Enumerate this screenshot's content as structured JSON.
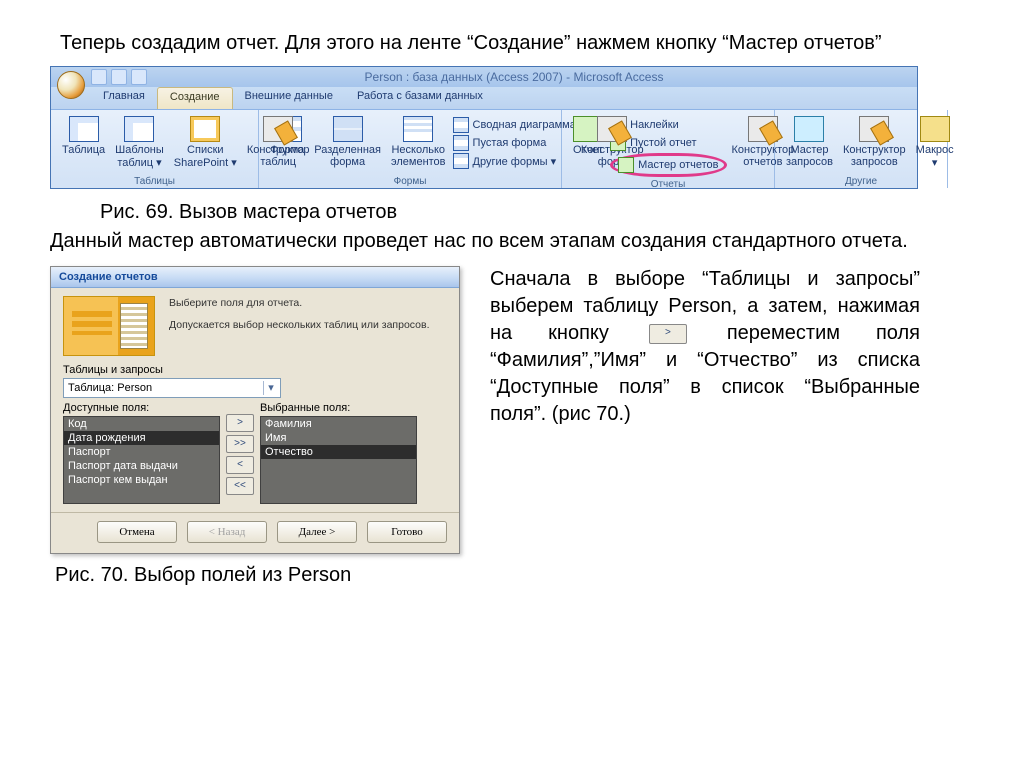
{
  "para1": "Теперь создадим отчет. Для этого на ленте “Создание” нажмем кнопку “Мастер отчетов”",
  "caption69": "Рис. 69. Вызов мастера отчетов",
  "para2": "Данный мастер автоматически проведет нас по всем этапам создания стандартного отчета.",
  "caption70": "Рис. 70. Выбор полей из Person",
  "aside": {
    "t1": "Сначала в выборе “Таблицы и запросы” выберем таблицу Person, а затем, нажимая на кнопку ",
    "btn": ">",
    "t2": " переместим поля “Фамилия”,”Имя” и “Отчество” из списка “Доступные поля” в список “Выбранные поля”. (рис 70.)"
  },
  "ribbon": {
    "title": "Person : база данных (Access 2007) - Microsoft Access",
    "tabs": {
      "home": "Главная",
      "create": "Создание",
      "external": "Внешние данные",
      "db": "Работа с базами данных"
    },
    "groups": {
      "tables": {
        "title": "Таблицы",
        "table": "Таблица",
        "templates": "Шаблоны\nтаблиц ▾",
        "sharepoint": "Списки\nSharePoint ▾",
        "design": "Конструктор\nтаблиц"
      },
      "forms": {
        "title": "Формы",
        "form": "Форма",
        "split": "Разделенная\nформа",
        "multi": "Несколько\nэлементов",
        "pivot": "Сводная диаграмма",
        "blank": "Пустая форма",
        "more": "Другие формы ▾",
        "design": "Конструктор\nформ"
      },
      "reports": {
        "title": "Отчеты",
        "report": "Отчет",
        "labels": "Наклейки",
        "blank": "Пустой отчет",
        "wizard": "Мастер отчетов",
        "design": "Конструктор\nотчетов"
      },
      "other": {
        "title": "Другие",
        "qwizard": "Мастер\nзапросов",
        "qdesign": "Конструктор\nзапросов",
        "macro": "Макрос\n▾"
      }
    }
  },
  "wizard": {
    "title": "Создание отчетов",
    "banner1": "Выберите поля для отчета.",
    "banner2": "Допускается выбор нескольких таблиц или запросов.",
    "tables_label": "Таблицы и запросы",
    "combo_value": "Таблица: Person",
    "avail_label": "Доступные поля:",
    "sel_label": "Выбранные поля:",
    "avail": [
      "Код",
      "Дата рождения",
      "Паспорт",
      "Паспорт дата выдачи",
      "Паспорт кем выдан"
    ],
    "selected": [
      "Фамилия",
      "Имя",
      "Отчество"
    ],
    "avail_sel_idx": 1,
    "sel_sel_idx": 2,
    "btn_move": ">",
    "btn_moveall": ">>",
    "btn_back": "<",
    "btn_backall": "<<",
    "cancel": "Отмена",
    "back": "< Назад",
    "next": "Далее >",
    "finish": "Готово"
  }
}
